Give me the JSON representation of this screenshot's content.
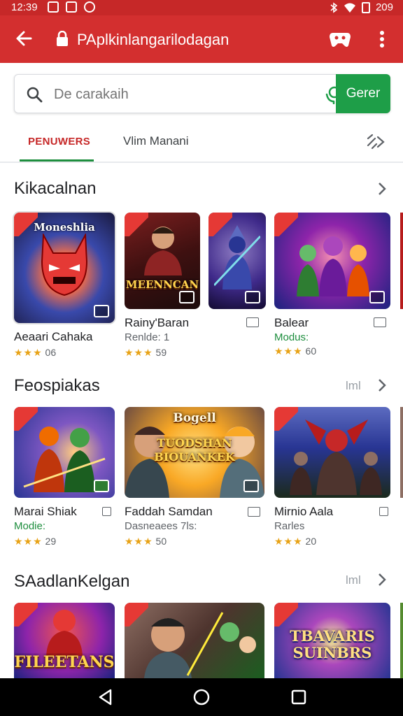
{
  "status": {
    "time": "12:39",
    "battery": "209"
  },
  "appbar": {
    "title": "PAplkinlangarilodagan"
  },
  "search": {
    "placeholder": "De carakaih",
    "button_label": "Gerer"
  },
  "tabs": [
    {
      "label": "PENUWERS",
      "active": true
    },
    {
      "label": "Vlim Manani",
      "active": false
    }
  ],
  "sections": [
    {
      "title": "Kikacalnan",
      "tag": "",
      "cards": [
        {
          "art_text": "Moneshlia",
          "name": "Aeaari Cahaka",
          "sub": "",
          "stars": "★★★",
          "rating": "06"
        },
        {
          "art_text": "MEENNCAN",
          "name": "Rainy'Baran",
          "sub": "Renlde: 1",
          "stars": "★★★",
          "rating": "59"
        },
        {
          "art_text": "",
          "name": "",
          "sub": "",
          "stars": "",
          "rating": ""
        },
        {
          "art_text": "",
          "name": "Balear",
          "sub": "Modus:",
          "stars": "★★★",
          "rating": "60"
        }
      ]
    },
    {
      "title": "Feospiakas",
      "tag": "lml",
      "cards": [
        {
          "art_text": "",
          "name": "Marai Shiak",
          "sub": "Modie:",
          "stars": "★★★",
          "rating": "29"
        },
        {
          "art_text": "TUODSHAN BIOUANKEK",
          "top_text": "Bogell",
          "name": "Faddah Samdan",
          "sub": "Dasneaees 7ls:",
          "stars": "★★★",
          "rating": "50"
        },
        {
          "art_text": "",
          "name": "Mirnio Aala",
          "sub": "Rarles",
          "stars": "★★★",
          "rating": "20"
        }
      ]
    },
    {
      "title": "SAadlanKelgan",
      "tag": "lml",
      "cards": [
        {
          "art_text": "FILEETANS"
        },
        {
          "art_text": ""
        },
        {
          "art_text": "TBAVARIS SUINBRS"
        }
      ]
    }
  ],
  "colors": {
    "appbar": "#d32f2f",
    "accent_green": "#1e9e48",
    "tab_active": "#c62828"
  }
}
